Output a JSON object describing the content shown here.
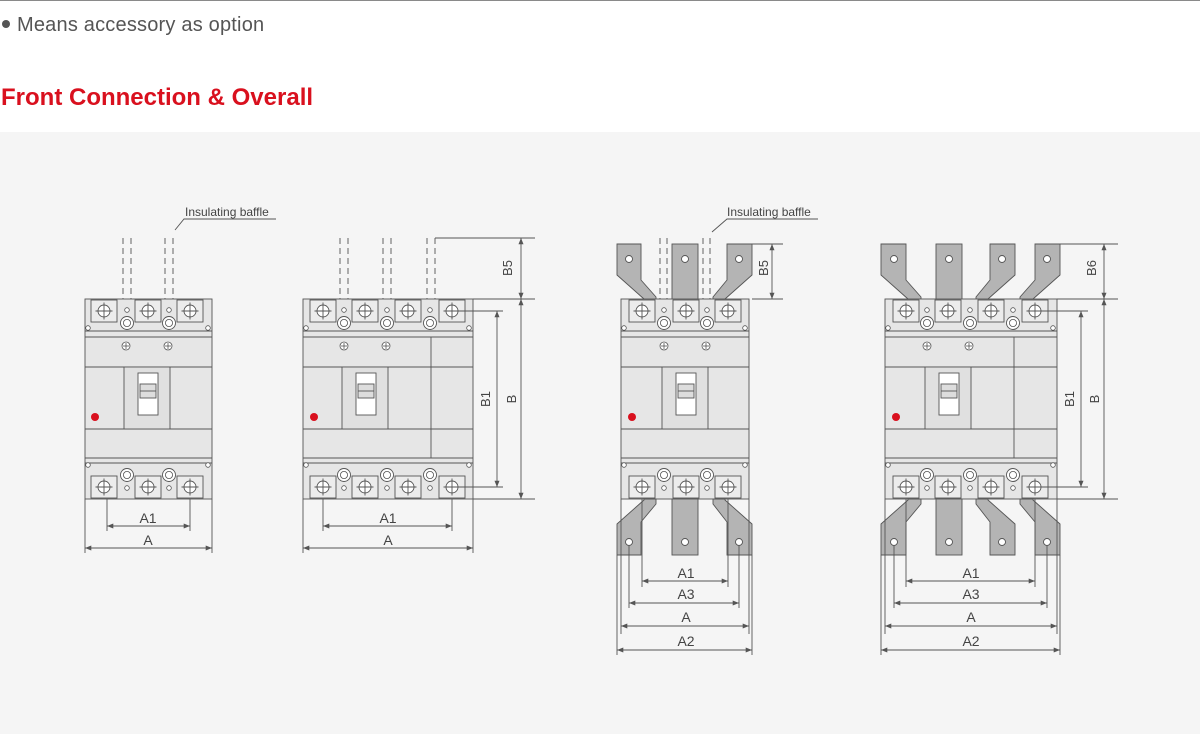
{
  "note": {
    "text": "Means accessory as option"
  },
  "section": {
    "title": "Front Connection & Overall"
  },
  "diagrams": {
    "d1": {
      "callout": "Insulating baffle",
      "a1": "A1",
      "a": "A"
    },
    "d2": {
      "b5": "B5",
      "b1": "B1",
      "b": "B",
      "a1": "A1",
      "a": "A"
    },
    "d3": {
      "callout": "Insulating baffle",
      "b5": "B5",
      "a1": "A1",
      "a3": "A3",
      "a": "A",
      "a2": "A2"
    },
    "d4": {
      "b6": "B6",
      "b1": "B1",
      "b": "B",
      "a1": "A1",
      "a3": "A3",
      "a": "A",
      "a2": "A2"
    }
  },
  "colors": {
    "accent": "#d9101e",
    "panel_bg": "#f5f5f5",
    "body_fill": "#e6e6e6",
    "busbar": "#b4b4b4",
    "line": "#555555"
  }
}
